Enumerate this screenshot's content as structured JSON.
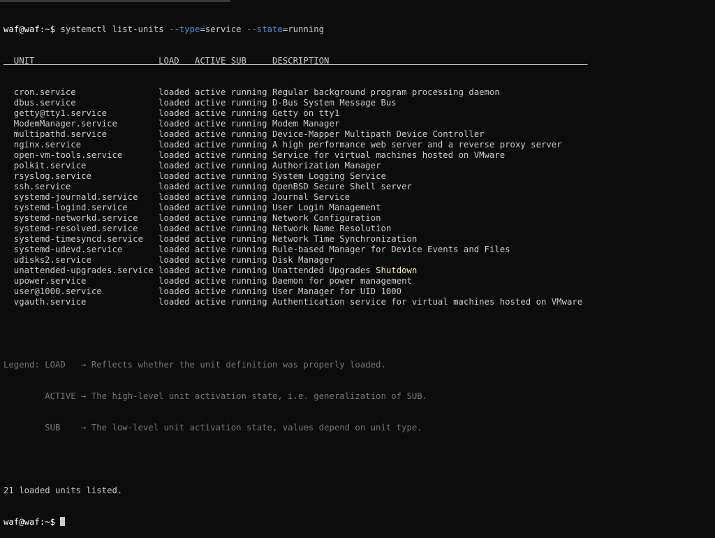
{
  "terminal": {
    "prompt": "waf@waf:~$ ",
    "command": {
      "base": "systemctl list-units ",
      "type_flag": "--type",
      "type_value": "=service ",
      "state_flag": "--state",
      "state_value": "=running"
    },
    "header": "  UNIT                        LOAD   ACTIVE SUB     DESCRIPTION                                                  ",
    "rows": [
      {
        "unit": "cron.service",
        "load": "loaded",
        "active": "active",
        "sub": "running",
        "description": "Regular background program processing daemon"
      },
      {
        "unit": "dbus.service",
        "load": "loaded",
        "active": "active",
        "sub": "running",
        "description": "D-Bus System Message Bus"
      },
      {
        "unit": "getty@tty1.service",
        "load": "loaded",
        "active": "active",
        "sub": "running",
        "description": "Getty on tty1"
      },
      {
        "unit": "ModemManager.service",
        "load": "loaded",
        "active": "active",
        "sub": "running",
        "description": "Modem Manager"
      },
      {
        "unit": "multipathd.service",
        "load": "loaded",
        "active": "active",
        "sub": "running",
        "description": "Device-Mapper Multipath Device Controller"
      },
      {
        "unit": "nginx.service",
        "load": "loaded",
        "active": "active",
        "sub": "running",
        "description": "A high performance web server and a reverse proxy server"
      },
      {
        "unit": "open-vm-tools.service",
        "load": "loaded",
        "active": "active",
        "sub": "running",
        "description": "Service for virtual machines hosted on VMware"
      },
      {
        "unit": "polkit.service",
        "load": "loaded",
        "active": "active",
        "sub": "running",
        "description": "Authorization Manager"
      },
      {
        "unit": "rsyslog.service",
        "load": "loaded",
        "active": "active",
        "sub": "running",
        "description": "System Logging Service"
      },
      {
        "unit": "ssh.service",
        "load": "loaded",
        "active": "active",
        "sub": "running",
        "description": "OpenBSD Secure Shell server"
      },
      {
        "unit": "systemd-journald.service",
        "load": "loaded",
        "active": "active",
        "sub": "running",
        "description": "Journal Service"
      },
      {
        "unit": "systemd-logind.service",
        "load": "loaded",
        "active": "active",
        "sub": "running",
        "description": "User Login Management"
      },
      {
        "unit": "systemd-networkd.service",
        "load": "loaded",
        "active": "active",
        "sub": "running",
        "description": "Network Configuration"
      },
      {
        "unit": "systemd-resolved.service",
        "load": "loaded",
        "active": "active",
        "sub": "running",
        "description": "Network Name Resolution"
      },
      {
        "unit": "systemd-timesyncd.service",
        "load": "loaded",
        "active": "active",
        "sub": "running",
        "description": "Network Time Synchronization"
      },
      {
        "unit": "systemd-udevd.service",
        "load": "loaded",
        "active": "active",
        "sub": "running",
        "description": "Rule-based Manager for Device Events and Files"
      },
      {
        "unit": "udisks2.service",
        "load": "loaded",
        "active": "active",
        "sub": "running",
        "description": "Disk Manager"
      },
      {
        "unit": "unattended-upgrades.service",
        "load": "loaded",
        "active": "active",
        "sub": "running",
        "description": "Unattended Upgrades ",
        "highlight": "Shutdown"
      },
      {
        "unit": "upower.service",
        "load": "loaded",
        "active": "active",
        "sub": "running",
        "description": "Daemon for power management"
      },
      {
        "unit": "user@1000.service",
        "load": "loaded",
        "active": "active",
        "sub": "running",
        "description": "User Manager for UID 1000"
      },
      {
        "unit": "vgauth.service",
        "load": "loaded",
        "active": "active",
        "sub": "running",
        "description": "Authentication service for virtual machines hosted on VMware"
      }
    ],
    "legend": [
      "Legend: LOAD   → Reflects whether the unit definition was properly loaded.",
      "        ACTIVE → The high-level unit activation state, i.e. generalization of SUB.",
      "        SUB    → The low-level unit activation state, values depend on unit type."
    ],
    "summary": "21 loaded units listed.",
    "final_prompt": "waf@waf:~$ ",
    "colors": {
      "background": "#0c0c0c",
      "text": "#cccccc",
      "flag": "#3a96dd",
      "dim": "#767676",
      "highlight": "#f9f1a5"
    }
  }
}
